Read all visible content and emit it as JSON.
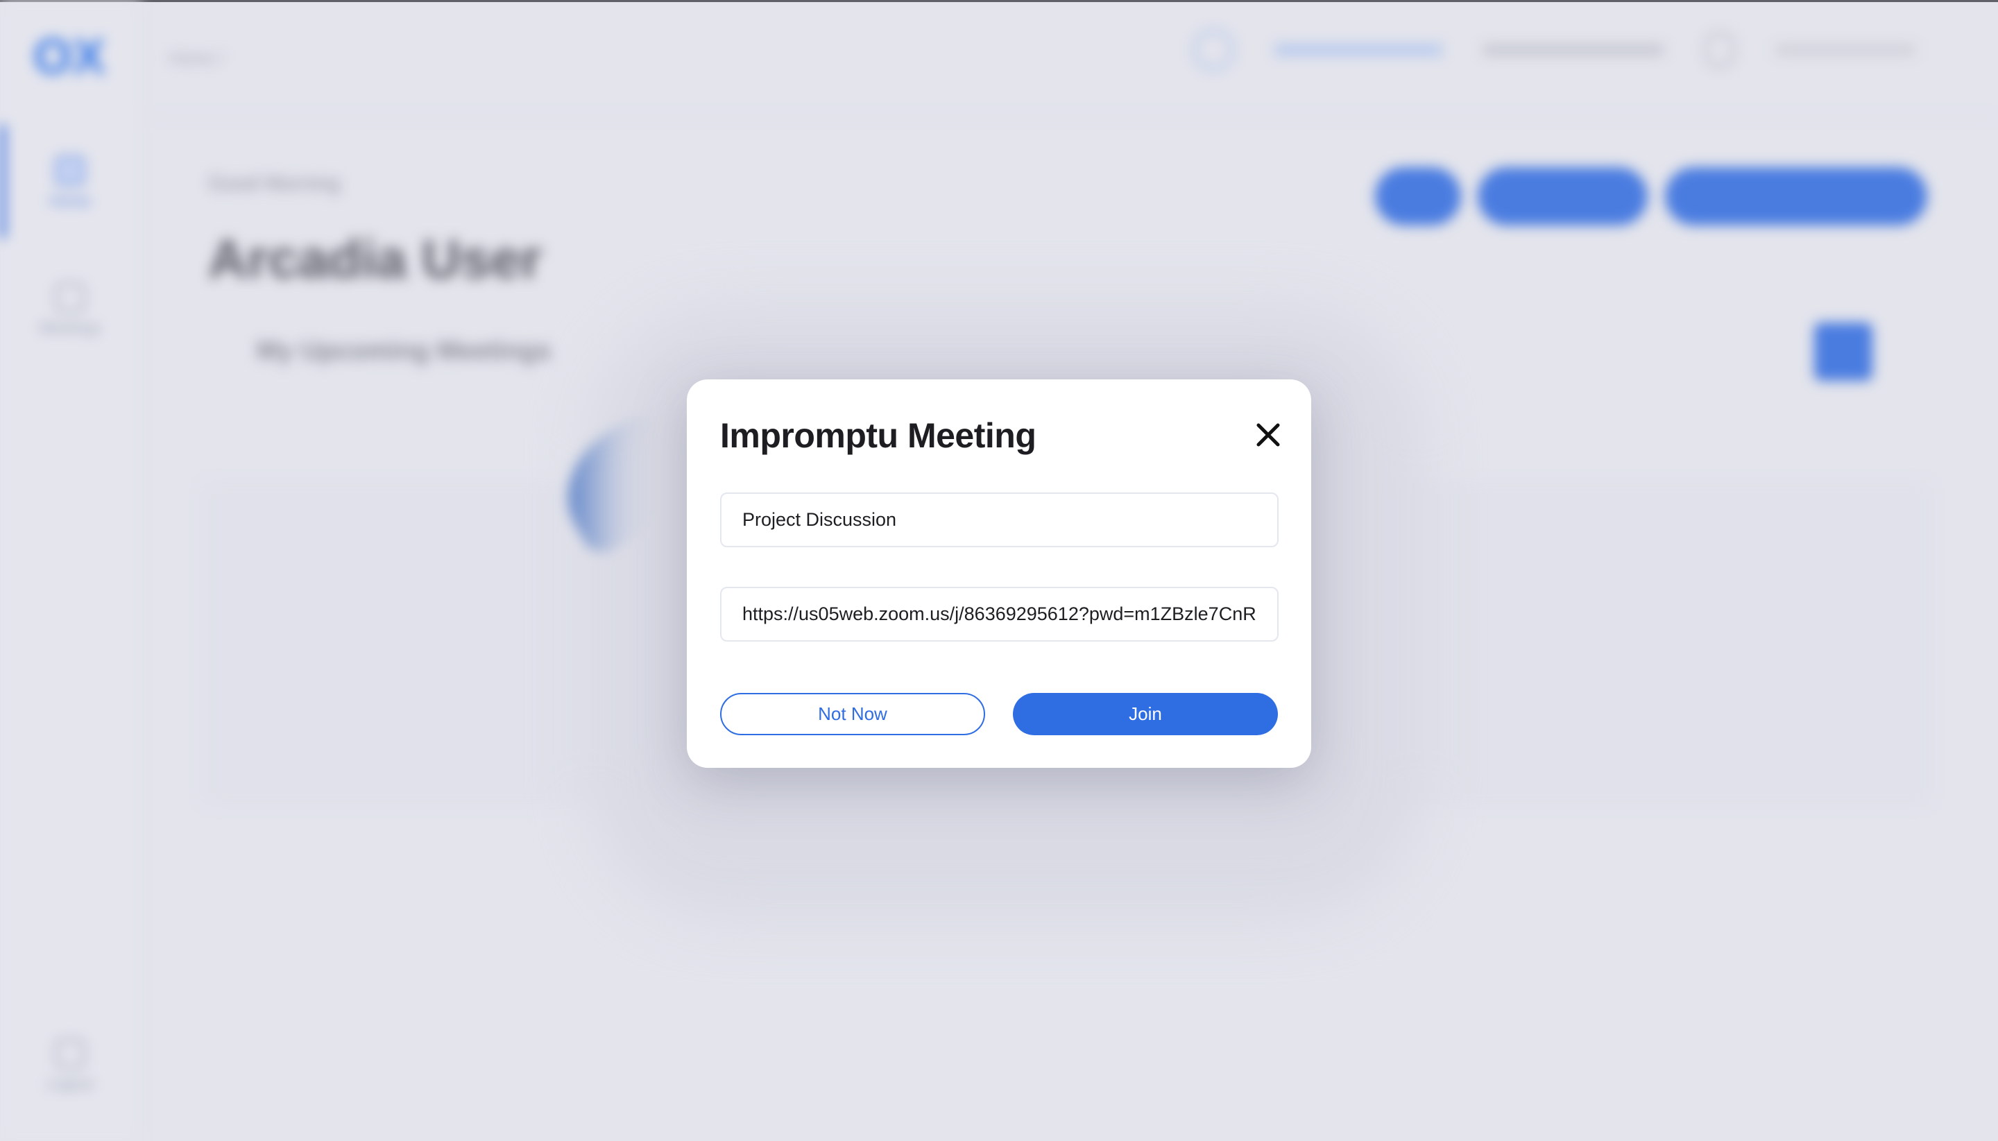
{
  "background": {
    "logo": "OX",
    "breadcrumb": "Home /",
    "sidebar": [
      {
        "label": "Home",
        "icon": "home-icon",
        "active": true
      },
      {
        "label": "Meetings",
        "icon": "calendar-icon",
        "active": false
      }
    ],
    "logout_label": "Logout",
    "greeting": "Good Morning",
    "user_name": "Arcadia User",
    "section_title": "My Upcoming Meetings"
  },
  "modal": {
    "title": "Impromptu Meeting",
    "meeting_name": "Project Discussion",
    "meeting_link": "https://us05web.zoom.us/j/86369295612?pwd=m1ZBzle7CnR",
    "not_now_label": "Not Now",
    "join_label": "Join"
  },
  "colors": {
    "accent": "#2f6de3",
    "overlay_bg": "#e3e4ec"
  }
}
